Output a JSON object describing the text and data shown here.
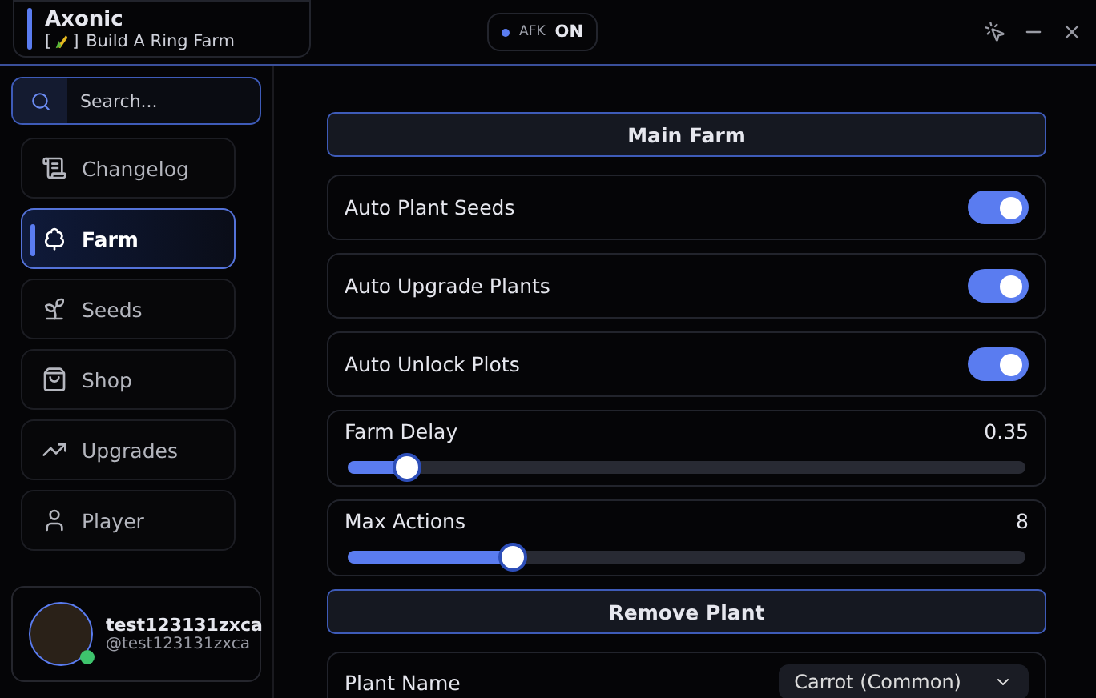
{
  "app": {
    "title": "Axonic",
    "tag_open": "[",
    "tag_close": "]",
    "subtitle": "Build A Ring Farm"
  },
  "afk": {
    "label": "AFK",
    "value": "ON",
    "on": true
  },
  "search": {
    "placeholder": "Search..."
  },
  "nav": [
    {
      "label": "Changelog",
      "selected": false
    },
    {
      "label": "Farm",
      "selected": true
    },
    {
      "label": "Seeds",
      "selected": false
    },
    {
      "label": "Shop",
      "selected": false
    },
    {
      "label": "Upgrades",
      "selected": false
    },
    {
      "label": "Player",
      "selected": false
    }
  ],
  "user": {
    "name": "test123131zxca",
    "handle": "@test123131zxca",
    "online": true
  },
  "sections": [
    {
      "title": "Main Farm",
      "items": [
        {
          "kind": "toggle",
          "label": "Auto Plant Seeds",
          "on": true
        },
        {
          "kind": "toggle",
          "label": "Auto Upgrade Plants",
          "on": true
        },
        {
          "kind": "toggle",
          "label": "Auto Unlock Plots",
          "on": true
        },
        {
          "kind": "slider",
          "label": "Farm Delay",
          "reading": "0.35",
          "level": 0.085
        },
        {
          "kind": "slider",
          "label": "Max Actions",
          "reading": "8",
          "level": 0.24
        }
      ]
    },
    {
      "title": "Remove Plant",
      "items": [
        {
          "kind": "dropdown",
          "label": "Plant Name",
          "value": "Carrot (Common)"
        }
      ]
    }
  ]
}
